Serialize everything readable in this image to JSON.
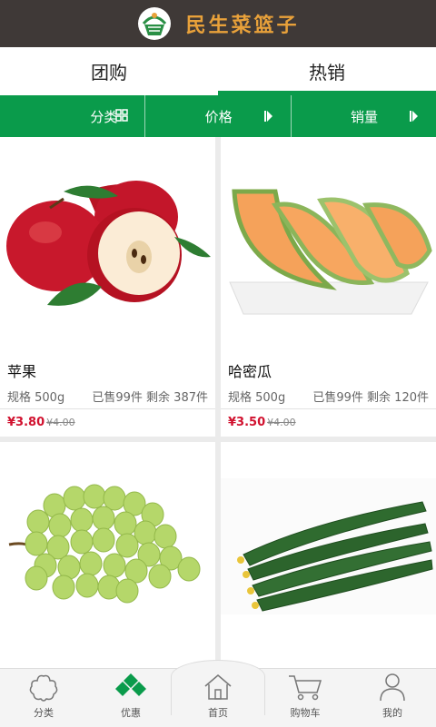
{
  "app": {
    "title": "民生菜篮子"
  },
  "tabs": [
    {
      "label": "团购",
      "active": false
    },
    {
      "label": "热销",
      "active": true
    }
  ],
  "filters": [
    {
      "label": "分类",
      "icon": "grid-icon"
    },
    {
      "label": "价格",
      "icon": "arrow-right-icon"
    },
    {
      "label": "销量",
      "icon": "arrow-right-icon"
    }
  ],
  "products": [
    {
      "name": "苹果",
      "spec": "规格 500g",
      "sold": "已售99件 剩余 387件",
      "price": "¥3.80",
      "old_price": "¥4.00",
      "image": "apple"
    },
    {
      "name": "哈密瓜",
      "spec": "规格 500g",
      "sold": "已售99件 剩余 120件",
      "price": "¥3.50",
      "old_price": "¥4.00",
      "image": "melon"
    },
    {
      "name": "",
      "spec": "",
      "sold": "",
      "price": "",
      "old_price": "",
      "image": "grapes"
    },
    {
      "name": "",
      "spec": "",
      "sold": "",
      "price": "",
      "old_price": "",
      "image": "cucumber"
    }
  ],
  "bottom_nav": [
    {
      "label": "分类",
      "icon": "flower-icon"
    },
    {
      "label": "优惠",
      "icon": "diamond-icon",
      "accent": "#0a9b4b"
    },
    {
      "label": "首页",
      "icon": "house-icon"
    },
    {
      "label": "购物车",
      "icon": "cart-icon"
    },
    {
      "label": "我的",
      "icon": "user-icon"
    }
  ],
  "colors": {
    "header": "#3f3937",
    "brand_green": "#0a9b4b",
    "title": "#e8a13a",
    "price": "#d1122f"
  }
}
